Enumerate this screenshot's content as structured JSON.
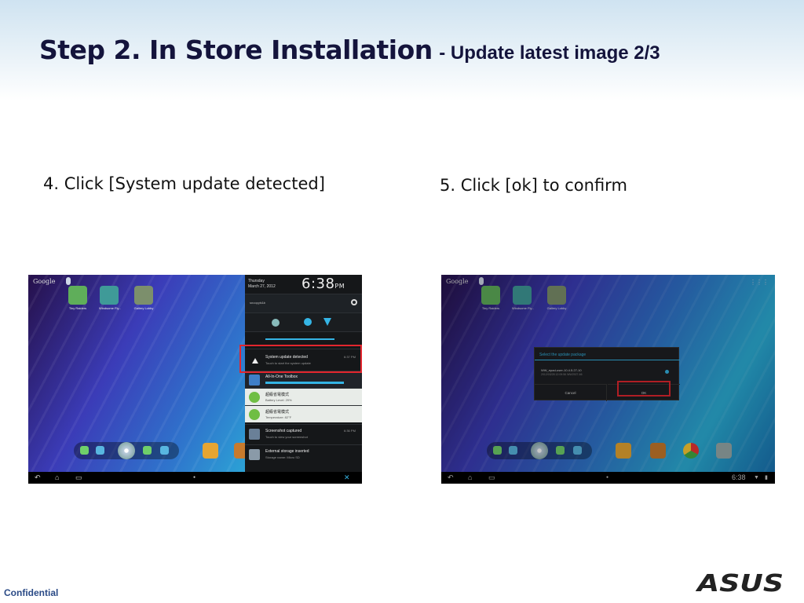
{
  "title": {
    "main": "Step 2. In Store Installation",
    "sub": "- Update latest image 2/3"
  },
  "steps": [
    {
      "caption": "4. Click [System update detected]"
    },
    {
      "caption": "5. Click [ok] to confirm"
    }
  ],
  "screenshot1": {
    "search_label": "Google",
    "apps": [
      {
        "label": "Tiny Raiders",
        "color": "#5fae5a"
      },
      {
        "label": "Windsome Fly...",
        "color": "#3f9a98"
      },
      {
        "label": "Gallery Lobby",
        "color": "#7c8f6c"
      }
    ],
    "dock_buttons": [
      "Email",
      "Apps",
      "Browse",
      "Market"
    ],
    "home_tiles": [
      {
        "label": "Cover Books",
        "color": "#e6a532"
      },
      {
        "label": "Daily Ne...",
        "color": "#c87a2c"
      }
    ],
    "panel": {
      "day": "Thursday",
      "date": "March 27, 2012",
      "time": "6:38",
      "ampm": "PM",
      "wifi_name": "snoopyb&b",
      "notifications": [
        {
          "title": "System update detected",
          "sub": "Touch to start the system update",
          "time": "6:37 PM"
        },
        {
          "title": "All-In-One Toolbox",
          "sub": "",
          "time": ""
        },
        {
          "title": "超級省電模式",
          "sub": "Battery Level: 29%",
          "time": ""
        },
        {
          "title": "超級省電模式",
          "sub": "Temperature: 82°F",
          "time": ""
        },
        {
          "title": "Screenshot captured",
          "sub": "Touch to view your screenshot",
          "time": "6:36 PM"
        },
        {
          "title": "External storage inserted",
          "sub": "Storage name: Micro SD",
          "time": ""
        }
      ]
    }
  },
  "screenshot2": {
    "search_label": "Google",
    "apps": [
      {
        "label": "Tiny Raiders",
        "color": "#5fae5a"
      },
      {
        "label": "Windsome Fly...",
        "color": "#3f9a98"
      },
      {
        "label": "Gallery Lobby",
        "color": "#7c8f6c"
      }
    ],
    "dialog": {
      "title": "Select the update package",
      "item_name": "WW_epad-user-10.4.5.27-10",
      "item_detail": "2012/03/28 12:09:56          WW2927-66",
      "cancel_label": "Cancel",
      "ok_label": "OK"
    },
    "status_time": "6:38"
  },
  "footer": {
    "confidential": "Confidential",
    "logo_text": "ASUS"
  },
  "colors": {
    "title": "#14143c",
    "highlight": "#e2262e",
    "accent_blue": "#35b5e5",
    "footer_text": "#2a4a86"
  }
}
